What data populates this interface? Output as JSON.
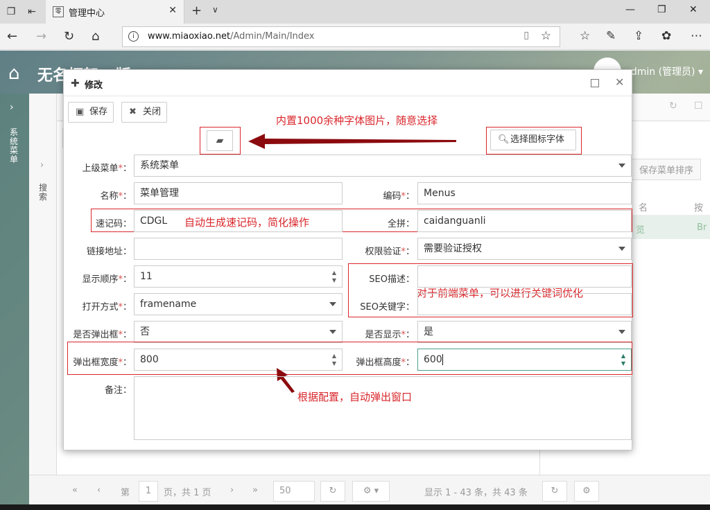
{
  "browser": {
    "tab_title": "管理中心",
    "favicon_text": "零",
    "url_domain": "www.miaoxiao.net",
    "url_path": "/Admin/Main/Index"
  },
  "app": {
    "brand": "无名框架 - 版",
    "user": "admin (管理员) ▾",
    "sidebar_vertical": "系统菜单",
    "panel_vertical": "搜索",
    "sort_button": "保存菜单排序",
    "col_a": "名",
    "col_b": "按",
    "row_a": "览",
    "row_b": "Br",
    "pager": {
      "page_prefix": "第",
      "page_number": "1",
      "page_suffix": "页，共 1 页",
      "page_size": "50",
      "summary": "显示 1 - 43 条，共 43 条"
    }
  },
  "modal": {
    "title": "修改",
    "save_label": "保存",
    "close_label": "关闭",
    "select_icon_label": "选择图标字体",
    "fields": {
      "parent_menu": {
        "label": "上级菜单",
        "value": "系统菜单"
      },
      "name": {
        "label": "名称",
        "value": "菜单管理"
      },
      "code": {
        "label": "编码",
        "value": "Menus"
      },
      "quick_code": {
        "label": "速记码：",
        "value": "CDGL"
      },
      "pinyin": {
        "label": "全拼：",
        "value": "caidanguanli"
      },
      "link": {
        "label": "链接地址：",
        "value": ""
      },
      "permission": {
        "label": "权限验证",
        "value": "需要验证授权"
      },
      "order": {
        "label": "显示顺序",
        "value": "11"
      },
      "seo_desc": {
        "label": "SEO描述：",
        "value": ""
      },
      "open_mode": {
        "label": "打开方式",
        "value": "framename"
      },
      "seo_keywords": {
        "label": "SEO关键字：",
        "value": ""
      },
      "is_popup": {
        "label": "是否弹出框",
        "value": "否"
      },
      "is_show": {
        "label": "是否显示",
        "value": "是"
      },
      "popup_width": {
        "label": "弹出框宽度",
        "value": "800"
      },
      "popup_height": {
        "label": "弹出框高度",
        "value": "600"
      },
      "remark": {
        "label": "备注：",
        "value": ""
      }
    },
    "required_mark": "*",
    "colon": "："
  },
  "annotations": {
    "icons_note": "内置1000余种字体图片，随意选择",
    "quick_code_note": "自动生成速记码，简化操作",
    "seo_note": "对于前端菜单，可以进行关键词优化",
    "popup_note": "根据配置，自动弹出窗口"
  },
  "colors": {
    "annotation": "#d9262b",
    "arrow": "#8b0a0e",
    "required": "#d9534f",
    "focus_border": "#4aa08a"
  }
}
